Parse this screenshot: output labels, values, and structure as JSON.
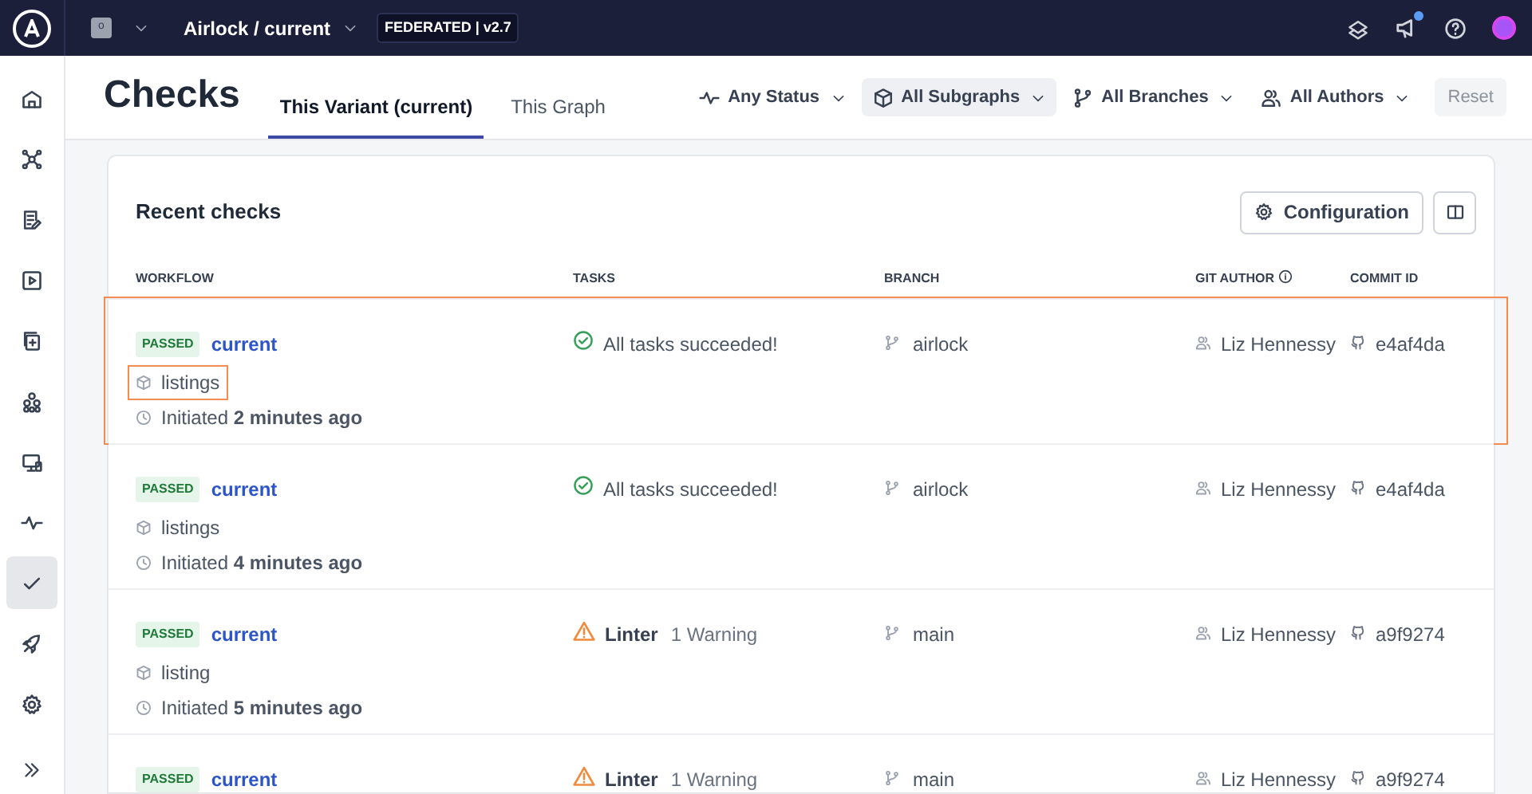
{
  "topbar": {
    "org_badge": "o",
    "graph": "Airlock / current",
    "federation_badge": "FEDERATED | v2.7",
    "notification_dot": true
  },
  "sidebar": {
    "items": [
      {
        "selected": false
      },
      {
        "selected": false
      },
      {
        "selected": false
      },
      {
        "selected": false
      },
      {
        "selected": false
      },
      {
        "selected": false
      },
      {
        "selected": false
      },
      {
        "selected": false
      },
      {
        "selected": true
      },
      {
        "selected": false
      },
      {
        "selected": false
      }
    ]
  },
  "page": {
    "title": "Checks",
    "tabs": [
      {
        "label": "This Variant (current)",
        "selected": true
      },
      {
        "label": "This Graph",
        "selected": false
      }
    ],
    "filters": [
      {
        "label": "Any Status",
        "selected": false
      },
      {
        "label": "All Subgraphs",
        "selected": true
      },
      {
        "label": "All Branches",
        "selected": false
      },
      {
        "label": "All Authors",
        "selected": false
      }
    ],
    "reset": {
      "label": "Reset",
      "disabled": true
    }
  },
  "card": {
    "title": "Recent checks",
    "configuration_button": "Configuration",
    "columns": [
      "WORKFLOW",
      "TASKS",
      "BRANCH",
      "GIT AUTHOR",
      "COMMIT ID"
    ],
    "rows": [
      {
        "status": "PASSED",
        "variant": "current",
        "subgraph": {
          "label": "listings",
          "highlighted": true
        },
        "initiated": "Initiated **2 minutes ago**",
        "task": {
          "kind": "success",
          "text": "All tasks succeeded!"
        },
        "branch": "airlock",
        "author": "Liz Hennessy",
        "commit": "e4af4da",
        "highlighted": true
      },
      {
        "status": "PASSED",
        "variant": "current",
        "subgraph": {
          "label": "listings",
          "highlighted": false
        },
        "initiated": "Initiated **4 minutes ago**",
        "task": {
          "kind": "success",
          "text": "All tasks succeeded!"
        },
        "branch": "airlock",
        "author": "Liz Hennessy",
        "commit": "e4af4da",
        "highlighted": false
      },
      {
        "status": "PASSED",
        "variant": "current",
        "subgraph": {
          "label": "listing",
          "highlighted": false
        },
        "initiated": "Initiated **5 minutes ago**",
        "task": {
          "kind": "warning",
          "name": "Linter",
          "detail": "1 Warning"
        },
        "branch": "main",
        "author": "Liz Hennessy",
        "commit": "a9f9274",
        "highlighted": false
      },
      {
        "status": "PASSED",
        "variant": "current",
        "task": {
          "kind": "warning",
          "name": "Linter",
          "detail": "1 Warning"
        },
        "branch": "main",
        "author": "Liz Hennessy",
        "commit": "a9f9274",
        "highlighted": false
      }
    ]
  }
}
